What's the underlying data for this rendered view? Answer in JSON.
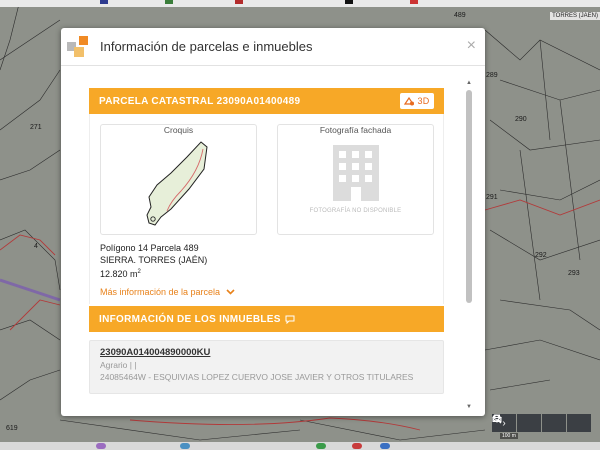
{
  "map": {
    "labels": [
      "271",
      "289",
      "290",
      "291",
      "292",
      "293",
      "489",
      "4",
      "619"
    ],
    "town_label": "TORRES (JAEN)",
    "scale_text": "100 m"
  },
  "modal": {
    "title": "Información de parcelas e inmuebles",
    "close_label": "×"
  },
  "parcela": {
    "header": "PARCELA CATASTRAL 23090A01400489",
    "btn_3d_label": "3D",
    "croquis_title": "Croquis",
    "fachada_title": "Fotografía fachada",
    "no_photo_text": "FOTOGRAFÍA NO DISPONIBLE",
    "poligono": "Polígono 14 Parcela 489",
    "location": "SIERRA. TORRES (JAÉN)",
    "area_value": "12.820 m",
    "area_sup": "2",
    "mas_info_label": "Más información de la parcela"
  },
  "inmuebles": {
    "header": "INFORMACIÓN DE LOS INMUEBLES",
    "items": [
      {
        "ref": "23090A014004890000KU",
        "use": "Agrario | |",
        "owner": "24085464W - ESQUIVIAS LOPEZ CUERVO JOSE JAVIER Y OTROS TITULARES"
      }
    ]
  },
  "colors": {
    "accent": "#f7a827",
    "link": "#e8821b"
  },
  "icons": {
    "header": "parcel-info-icon",
    "btn_3d": "3d-icon",
    "inmuebles": "chat-icon",
    "mas_info": "chevron-down-icon",
    "controls": [
      "chevron-right-icon",
      "search-icon",
      "layers-icon",
      "print-icon"
    ]
  }
}
